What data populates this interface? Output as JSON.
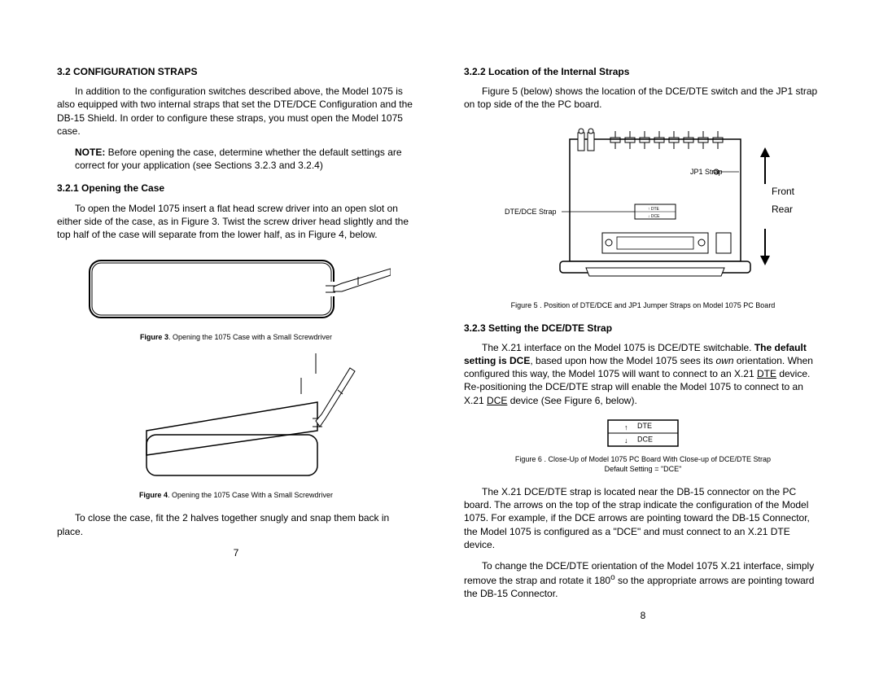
{
  "left": {
    "heading_3_2": "3.2  CONFIGURATION STRAPS",
    "para1": "In addition to the configuration switches described above, the Model 1075 is also equipped with two internal straps that set the DTE/DCE Configuration and the DB-15 Shield.  In order to configure these straps, you must open the Model 1075 case.",
    "note_label": "NOTE:",
    "note_body": "  Before opening the case, determine whether the default settings are correct for your application (see Sections 3.2.3 and 3.2.4)",
    "heading_3_2_1": "3.2.1  Opening the Case",
    "para2": "To open the Model 1075  insert a flat head screw driver into an open slot on either side of the case, as in Figure 3. Twist the screw driver head slightly and the top half of the case will separate from the lower half, as in Figure  4, below.",
    "fig3_bold": "Figure 3",
    "fig3_rest": ".  Opening the 1075 Case with a Small Screwdriver",
    "fig4_bold": "Figure 4",
    "fig4_rest": ".  Opening the 1075 Case With a Small Screwdriver",
    "para3": "To close the case, fit the 2 halves together snugly and snap them back in place.",
    "pagenum": "7"
  },
  "right": {
    "heading_3_2_2": "3.2.2  Location of the Internal Straps",
    "para1": "Figure 5 (below) shows the location of the DCE/DTE switch and the JP1 strap on top side of the the PC board.",
    "jp1_label": "JP1 Strap",
    "dtedce_label": "DTE/DCE Strap",
    "front": "Front",
    "rear": "Rear",
    "fig5_caption": "Figure 5 .  Position of DTE/DCE and JP1 Jumper Straps on Model 1075 PC Board",
    "heading_3_2_3": "3.2.3 Setting the DCE/DTE Strap",
    "para2a": "The X.21 interface on the Model 1075 is DCE/DTE switchable.  ",
    "para2b_bold": "The default setting is DCE",
    "para2c": ", based upon how the Model 1075 sees its ",
    "para2d_italic": "own",
    "para2e": " orientation.  When configured this way, the Model 1075 will want to connect to an X.21 ",
    "para2f_under": "DTE",
    "para2g": " device.  Re-positioning the DCE/DTE strap will enable the Model 1075 to connect to an X.21 ",
    "para2h_under": "DCE",
    "para2i": " device (See Figure 6, below).",
    "strap_dte": "DTE",
    "strap_dce": "DCE",
    "fig6_line1": "Figure 6 .  Close-Up of Model 1075 PC Board With Close-up of DCE/DTE Strap",
    "fig6_line2": "Default Setting = \"DCE\"",
    "para3": "The X.21 DCE/DTE strap is located near the DB-15 connector on the PC board.   The arrows on the top of the strap indicate the configuration of the Model 1075.  For example, if the DCE arrows are pointing toward the DB-15 Connector, the Model 1075 is configured as a \"DCE\"  and must connect to an X.21 DTE device.",
    "para4a": "To change the DCE/DTE orientation of the Model 1075 X.21 interface, simply remove the strap and rotate it 180",
    "para4b_sup": "o",
    "para4c": " so the appropriate arrows are pointing toward the DB-15 Connector.",
    "pagenum": "8"
  }
}
